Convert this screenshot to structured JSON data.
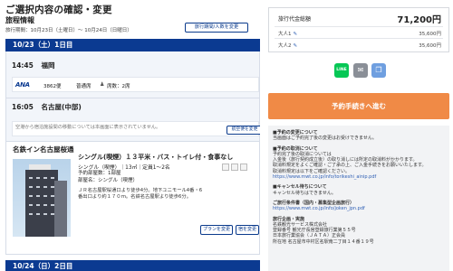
{
  "page": {
    "title": "ご選択内容の確認・変更",
    "subtitle": "旅程情報",
    "period": "旅行期間：10月23日（土曜日）～ 10月24日（日曜日）",
    "change_date_button": "旅行期間/人数を変更"
  },
  "days": [
    {
      "label": "10/23（土）1日目"
    },
    {
      "label": "10/24（日）2日目"
    }
  ],
  "segments": {
    "departure": {
      "time": "14:45",
      "place": "福岡"
    },
    "flight": {
      "airline": "ANA",
      "number": "3862便",
      "class": "普通席",
      "seats": "席数：2席"
    },
    "arrival": {
      "time": "16:05",
      "place": "名古屋(中部)"
    },
    "car_note": "空港から宿泊施設間の移動については本画面に表示されていません。",
    "car_button": "航空便を変更"
  },
  "hotel": {
    "name": "名鉄イン名古屋桜通",
    "room_title": "シングル(喫煙）１３平米・バス・トイレ付・食事なし",
    "room_info": "シングル（喫煙）｜13㎡｜定員1～2名",
    "rooms": "予約部屋数：1部屋",
    "room_type": "部屋名：シングル（喫煙）",
    "access": "ＪＲ名古屋駅桜通口より徒歩4分。地下ユニモール4番・6番出口より約１７０ｍ。名鉄名古屋駅より徒歩6分。",
    "plan_button": "プランを変更",
    "stay_button": "宿を変更"
  },
  "summary": {
    "total_label": "旅行代金総額",
    "total_value": "71,200円",
    "rows": [
      {
        "label": "大人1",
        "amount": "35,600円"
      },
      {
        "label": "大人2",
        "amount": "35,600円"
      }
    ],
    "share_line": "LINE",
    "proceed_button": "予約手続きへ進む"
  },
  "notes": {
    "change_h": "■予約の変更について",
    "change_t": "当画面はご予約完了後の変更はお受けできません。",
    "cancel_h": "■予約の取消について",
    "cancel_t1": "予約完了後の取消については",
    "cancel_t2": "入金後（旅行契約成立後）の取り消しには所定の取消料がかかります。",
    "cancel_t3": "取消料規定をよくご確認・ご了承の上、ご入金手続きをお願いいたします。",
    "cancel_t4": "取消料規定は以下をご確認ください。",
    "cancel_link": "https://www.mwt.co.jp/info/torikeshi_ainip.pdf",
    "delay_h": "■キャンセル待ちについて",
    "delay_t": "キャンセル待ちはできません。",
    "terms_h": "ご旅行条件書（国内・募集型企画旅行）",
    "terms_link": "https://www.mwt.co.jp/info/joken_jpn.pdf",
    "org_h": "旅行企画・実施",
    "org_1": "名鉄観光サービス株式会社",
    "org_2": "登録番号 観光庁長官登録旅行業第５５号",
    "org_3": "日本旅行業協会（ＪＡＴＡ）正会員",
    "org_4": "所在地 名古屋市中村区名駅南二丁目１４番１９号"
  }
}
